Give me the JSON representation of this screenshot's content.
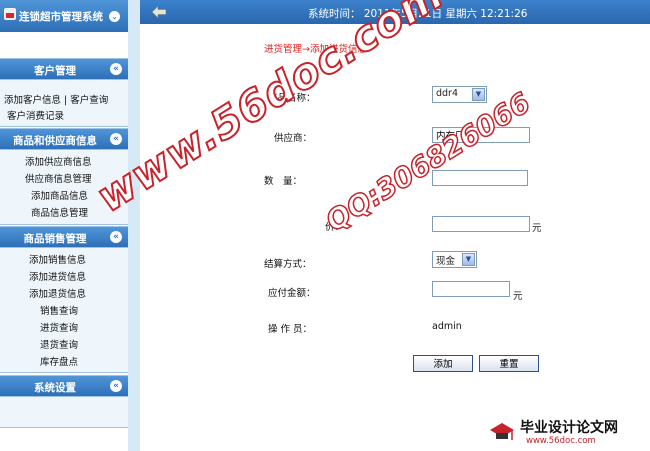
{
  "sidebar": {
    "app_title": "连锁超市管理系统",
    "customer_section": {
      "title": "客户管理",
      "items": [
        "添加客户信息 | 客户查询",
        "客户消费记录"
      ]
    },
    "supplier_section": {
      "title": "商品和供应商信息",
      "items": [
        "添加供应商信息",
        "供应商信息管理",
        "添加商品信息",
        "商品信息管理"
      ]
    },
    "sales_section": {
      "title": "商品销售管理",
      "items": [
        "添加销售信息",
        "添加进货信息",
        "添加退货信息",
        "销售查询",
        "进货查询",
        "退货查询",
        "库存盘点"
      ]
    },
    "system_section": {
      "title": "系统设置"
    }
  },
  "topbar": {
    "system_time": "系统时间： 2011年5月21日 星期六 12:21:26"
  },
  "breadcrumb": "进货管理→添加进货信息",
  "form": {
    "product_name_label": "商品名称：",
    "product_name_value": "ddr4",
    "supplier_label": "供应商：",
    "supplier_value": "内存厂",
    "quantity_label": "数　量：",
    "quantity_value": "",
    "price_label": "价：",
    "price_value": "",
    "price_unit": "元",
    "payment_method_label": "结算方式：",
    "payment_method_value": "现金",
    "amount_due_label": "应付金额：",
    "amount_due_value": "",
    "amount_unit": "元",
    "operator_label": "操 作 员：",
    "operator_value": "admin",
    "submit_label": "添加",
    "reset_label": "重置"
  },
  "watermark": {
    "site": "www.56doc.com",
    "qq": "QQ:306826066",
    "corner_title": "毕业设计论文网",
    "corner_url": "www.56doc.com"
  },
  "colors": {
    "header_blue": "#2d6fb6",
    "breadcrumb_red": "#dd2222",
    "watermark_red": "#c8222a"
  }
}
